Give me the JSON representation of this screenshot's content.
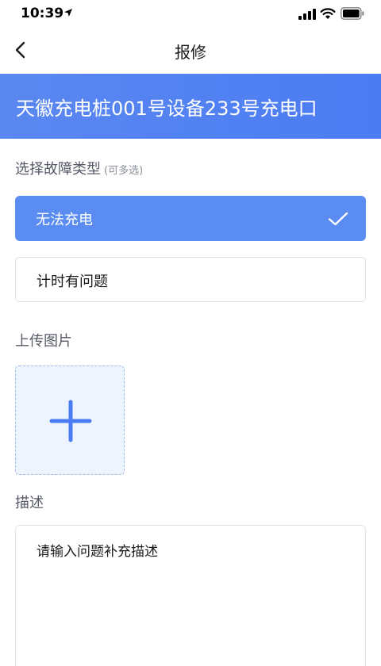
{
  "status_bar": {
    "time": "10:39",
    "icons": [
      "location-arrow-icon",
      "signal-icon",
      "wifi-icon",
      "battery-icon"
    ]
  },
  "nav": {
    "title": "报修",
    "back_icon": "chevron-left-icon"
  },
  "device": {
    "name": "天徽充电桩001号设备233号充电口"
  },
  "fault_type": {
    "label": "选择故障类型",
    "hint": "(可多选)",
    "options": [
      {
        "label": "无法充电",
        "selected": true
      },
      {
        "label": "计时有问题",
        "selected": false
      }
    ]
  },
  "upload": {
    "label": "上传图片",
    "icon": "plus-icon"
  },
  "description": {
    "label": "描述",
    "placeholder": "请输入问题补充描述",
    "value": ""
  },
  "colors": {
    "accent": "#4a7cf3",
    "banner_start": "#5b87f0",
    "selected_option": "#5a8cf2",
    "upload_bg": "#eef4fd"
  }
}
